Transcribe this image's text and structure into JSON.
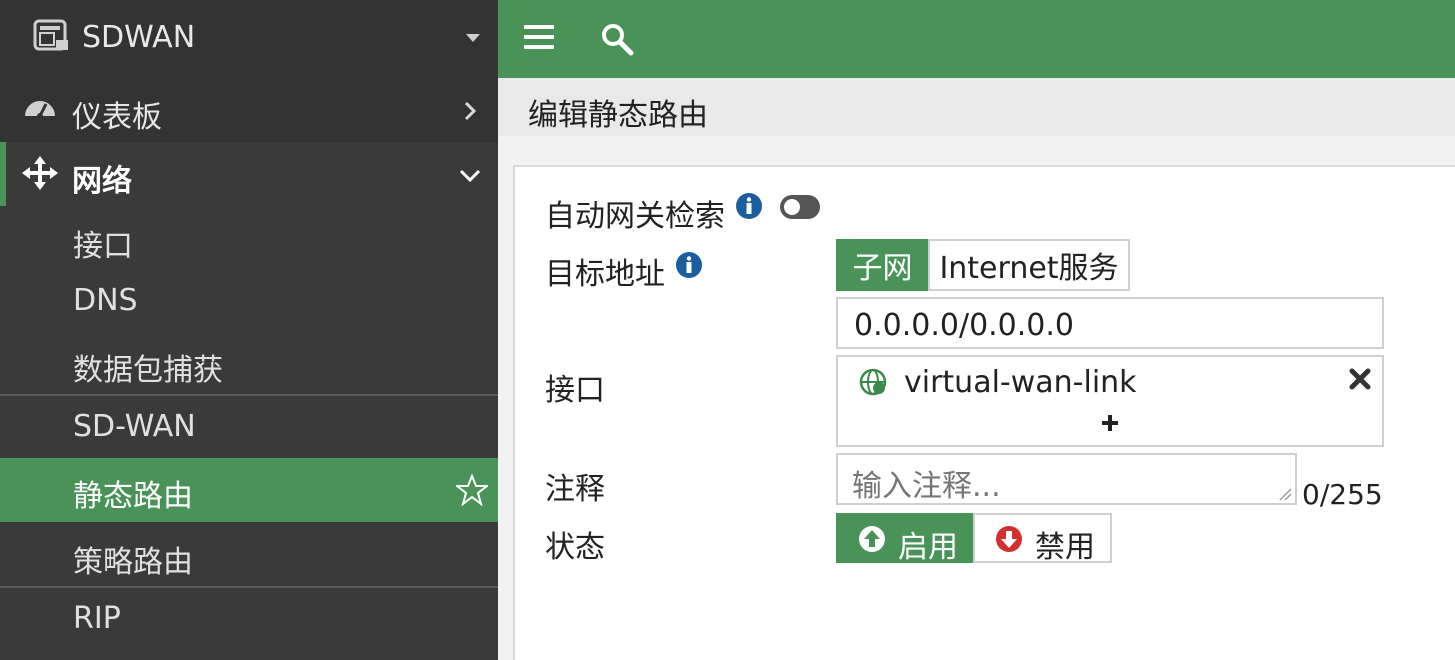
{
  "app": {
    "title": "SDWAN"
  },
  "sidebar": {
    "dashboard": "仪表板",
    "network": "网络",
    "items": [
      {
        "label": "接口"
      },
      {
        "label": "DNS"
      },
      {
        "label": "数据包捕获"
      },
      {
        "label": "SD-WAN"
      },
      {
        "label": "静态路由",
        "active": true
      },
      {
        "label": "策略路由"
      },
      {
        "label": "RIP"
      }
    ]
  },
  "header": {
    "page_title": "编辑静态路由"
  },
  "form": {
    "auto_gateway_label": "自动网关检索",
    "auto_gateway_enabled": false,
    "destination_label": "目标地址",
    "destination_options": [
      "子网",
      "Internet服务"
    ],
    "destination_selected": "子网",
    "destination_value": "0.0.0.0/0.0.0.0",
    "interface_label": "接口",
    "interface_value": "virtual-wan-link",
    "comment_label": "注释",
    "comment_placeholder": "输入注释...",
    "comment_counter": "0/255",
    "status_label": "状态",
    "status_enable": "启用",
    "status_disable": "禁用",
    "status_selected": "启用"
  },
  "colors": {
    "accent": "#4a9358",
    "sidebar_bg": "#3a3a3a",
    "info": "#1b5e9e",
    "disable_red": "#d32f2f"
  }
}
